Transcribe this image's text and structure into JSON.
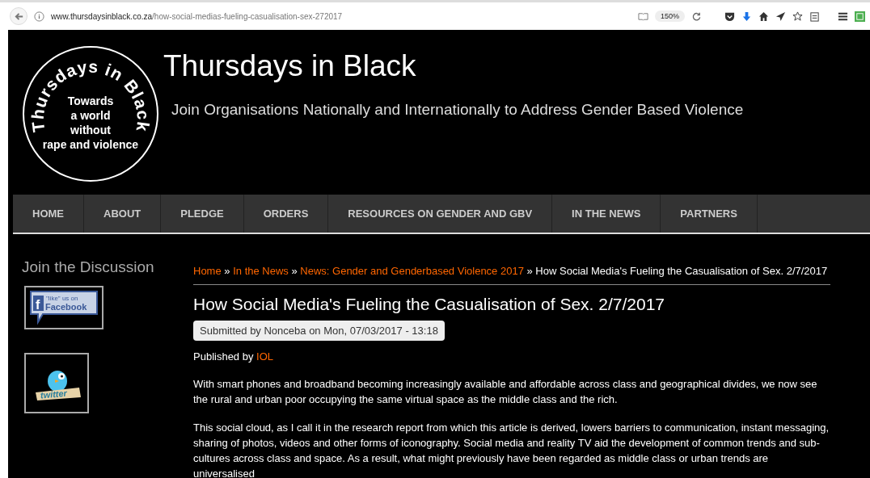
{
  "browser": {
    "url_domain": "www.thursdaysinblack.co.za",
    "url_path": "/how-social-medias-fueling-casualisation-sex-272017",
    "zoom": "150%"
  },
  "header": {
    "logo": {
      "ring_text": "Thursdays in Black",
      "inner_lines": [
        "Towards",
        "a world",
        "without",
        "rape and violence"
      ]
    },
    "title": "Thursdays in Black",
    "subtitle": "Join Organisations Nationally and Internationally to Address Gender Based Violence"
  },
  "nav": [
    {
      "label": "HOME"
    },
    {
      "label": "ABOUT"
    },
    {
      "label": "PLEDGE"
    },
    {
      "label": "ORDERS"
    },
    {
      "label": "RESOURCES ON GENDER AND GBV"
    },
    {
      "label": "IN THE NEWS"
    },
    {
      "label": "PARTNERS"
    }
  ],
  "sidebar": {
    "heading": "Join the Discussion",
    "facebook": {
      "letter": "f",
      "small": "\"like\" us on",
      "label": "Facebook"
    },
    "twitter": {
      "label": "twitter"
    }
  },
  "breadcrumb": {
    "links": [
      "Home",
      "In the News",
      "News: Gender and Genderbased Violence 2017"
    ],
    "current": "How Social Media's Fueling the Casualisation of Sex. 2/7/2017",
    "separator": "»"
  },
  "article": {
    "title": "How Social Media's Fueling the Casualisation of Sex. 2/7/2017",
    "submitted": "Submitted by Nonceba on Mon, 07/03/2017 - 13:18",
    "published_prefix": "Published by",
    "publisher": "IOL",
    "paragraphs": [
      "With smart phones and broadband becoming increasingly available and affordable across class and geographical divides, we now see the rural and urban poor occupying the same virtual space as the middle class and the rich.",
      "This social cloud, as I call it in the research report from which this article is derived, lowers barriers to communication, instant messaging, sharing of photos, videos and other forms of iconography. Social media and reality TV aid the development of common trends and sub-cultures across class and space. As a result, what might previously have been regarded as middle class or urban trends are universalised"
    ]
  }
}
